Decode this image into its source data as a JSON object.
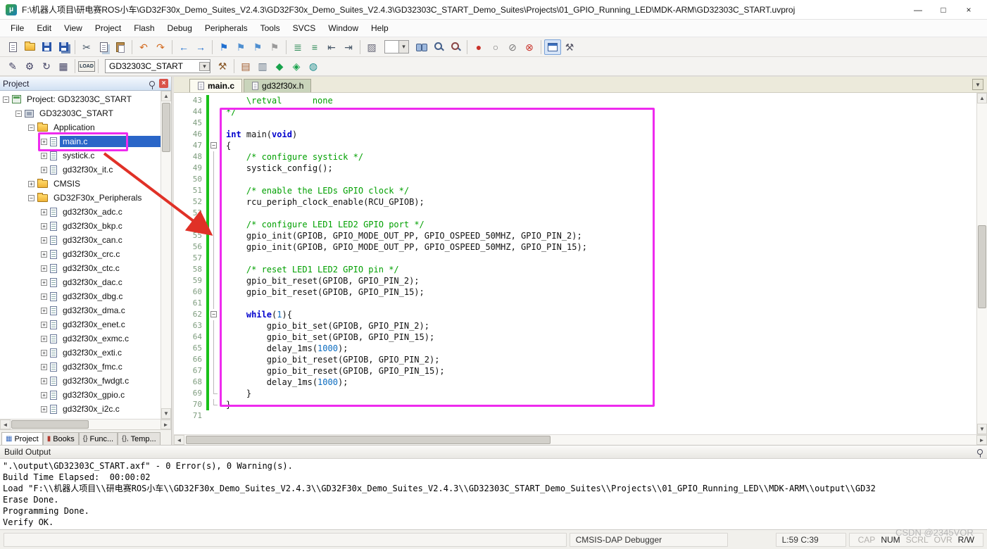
{
  "window": {
    "title": "F:\\机器人项目\\研电赛ROS小车\\GD32F30x_Demo_Suites_V2.4.3\\GD32F30x_Demo_Suites_V2.4.3\\GD32303C_START_Demo_Suites\\Projects\\01_GPIO_Running_LED\\MDK-ARM\\GD32303C_START.uvproj",
    "controls": {
      "minimize": "—",
      "maximize": "□",
      "close": "×"
    }
  },
  "menubar": {
    "items": [
      "File",
      "Edit",
      "View",
      "Project",
      "Flash",
      "Debug",
      "Peripherals",
      "Tools",
      "SVCS",
      "Window",
      "Help"
    ]
  },
  "toolbar_main": {
    "items": [
      {
        "name": "new-file-icon",
        "cls": "ic-page"
      },
      {
        "name": "open-folder-icon",
        "cls": "ic-folder"
      },
      {
        "name": "save-icon",
        "cls": "ic-floppy"
      },
      {
        "name": "save-all-icon",
        "cls": "ic-floppy ic-floppy-all"
      },
      {
        "sep": true
      },
      {
        "name": "cut-icon",
        "glyph": "✂",
        "color": "#445566"
      },
      {
        "name": "copy-icon",
        "cls": "ic-page ic-copy"
      },
      {
        "name": "paste-icon",
        "cls": "ic-paste"
      },
      {
        "sep": true
      },
      {
        "name": "undo-icon",
        "glyph": "↶",
        "color": "#d2691e"
      },
      {
        "name": "redo-icon",
        "glyph": "↷",
        "color": "#d2691e"
      },
      {
        "sep": true
      },
      {
        "name": "navigate-back-icon",
        "glyph": "←",
        "color": "#1f6fd0"
      },
      {
        "name": "navigate-forward-icon",
        "glyph": "→",
        "color": "#1f6fd0"
      },
      {
        "sep": true
      },
      {
        "name": "bookmark-toggle-icon",
        "glyph": "⚑",
        "color": "#1f6fd0"
      },
      {
        "name": "bookmark-previous-icon",
        "glyph": "⚑",
        "color": "#4f8fd0"
      },
      {
        "name": "bookmark-next-icon",
        "glyph": "⚑",
        "color": "#4f8fd0"
      },
      {
        "name": "bookmark-clear-all-icon",
        "glyph": "⚑",
        "color": "#9a9a9a"
      },
      {
        "sep": true
      },
      {
        "name": "comment-selection-icon",
        "glyph": "≣",
        "color": "#2e8b57"
      },
      {
        "name": "uncomment-selection-icon",
        "glyph": "≡",
        "color": "#2e8b57"
      },
      {
        "name": "indent-left-icon",
        "glyph": "⇤",
        "color": "#445566"
      },
      {
        "name": "indent-right-icon",
        "glyph": "⇥",
        "color": "#445566"
      },
      {
        "sep": true
      },
      {
        "name": "edit-configuration-icon",
        "glyph": "▨",
        "color": "#666677"
      },
      {
        "combo": true,
        "name": "search-combo"
      },
      {
        "name": "find-in-files-icon",
        "cls": "ic-binoc"
      },
      {
        "name": "find-icon",
        "cls": "ic-mag"
      },
      {
        "name": "incremental-find-icon",
        "cls": "ic-mag ic-mag-inc"
      },
      {
        "sep": true
      },
      {
        "name": "breakpoint-insert-icon",
        "glyph": "●",
        "color": "#c9322a"
      },
      {
        "name": "breakpoint-enable-icon",
        "glyph": "○",
        "color": "#777777"
      },
      {
        "name": "breakpoints-disable-all-icon",
        "glyph": "⊘",
        "color": "#777777"
      },
      {
        "name": "breakpoints-kill-all-icon",
        "glyph": "⊗",
        "color": "#c9322a"
      },
      {
        "sep": true
      },
      {
        "name": "debug-windows-icon",
        "cls": "ic-window",
        "pressed": true
      },
      {
        "name": "configuration-wrench-icon",
        "glyph": "⚒",
        "color": "#556"
      }
    ]
  },
  "toolbar_build": {
    "items": [
      {
        "name": "translate-file-icon",
        "glyph": "✎",
        "color": "#444466"
      },
      {
        "name": "build-icon",
        "glyph": "⚙",
        "color": "#444466"
      },
      {
        "name": "rebuild-all-icon",
        "glyph": "↻",
        "color": "#444466"
      },
      {
        "name": "batch-build-icon",
        "glyph": "▦",
        "color": "#444466"
      },
      {
        "sep": true
      },
      {
        "name": "download-load-icon",
        "label": "LOAD"
      },
      {
        "sep": true
      },
      {
        "select": true,
        "name": "target-select",
        "value": "GD32303C_START"
      },
      {
        "name": "options-for-target-icon",
        "glyph": "⚒",
        "color": "#8a5a2a"
      },
      {
        "sep": true
      },
      {
        "name": "manage-project-items-icon",
        "glyph": "▤",
        "color": "#a05a2c"
      },
      {
        "name": "manage-books-icon",
        "glyph": "▥",
        "color": "#667788"
      },
      {
        "name": "manage-rte-icon",
        "glyph": "◆",
        "color": "#17a24b"
      },
      {
        "name": "select-software-packs-icon",
        "glyph": "◈",
        "color": "#17a24b"
      },
      {
        "name": "pack-installer-icon",
        "glyph": "◍",
        "color": "#178a8a"
      }
    ]
  },
  "project_panel": {
    "title": "Project",
    "tree": [
      {
        "depth": 0,
        "expand": "minus",
        "icon": "project",
        "label": "Project: GD32303C_START"
      },
      {
        "depth": 1,
        "expand": "minus",
        "icon": "target",
        "label": "GD32303C_START"
      },
      {
        "depth": 2,
        "expand": "minus",
        "icon": "folder",
        "label": "Application"
      },
      {
        "depth": 3,
        "expand": "plus",
        "icon": "file",
        "label": "main.c",
        "selected": true
      },
      {
        "depth": 3,
        "expand": "plus",
        "icon": "file",
        "label": "systick.c"
      },
      {
        "depth": 3,
        "expand": "plus",
        "icon": "file",
        "label": "gd32f30x_it.c"
      },
      {
        "depth": 2,
        "expand": "plus",
        "icon": "folder",
        "label": "CMSIS"
      },
      {
        "depth": 2,
        "expand": "minus",
        "icon": "folder",
        "label": "GD32F30x_Peripherals"
      },
      {
        "depth": 3,
        "expand": "plus",
        "icon": "file",
        "label": "gd32f30x_adc.c"
      },
      {
        "depth": 3,
        "expand": "plus",
        "icon": "file",
        "label": "gd32f30x_bkp.c"
      },
      {
        "depth": 3,
        "expand": "plus",
        "icon": "file",
        "label": "gd32f30x_can.c"
      },
      {
        "depth": 3,
        "expand": "plus",
        "icon": "file",
        "label": "gd32f30x_crc.c"
      },
      {
        "depth": 3,
        "expand": "plus",
        "icon": "file",
        "label": "gd32f30x_ctc.c"
      },
      {
        "depth": 3,
        "expand": "plus",
        "icon": "file",
        "label": "gd32f30x_dac.c"
      },
      {
        "depth": 3,
        "expand": "plus",
        "icon": "file",
        "label": "gd32f30x_dbg.c"
      },
      {
        "depth": 3,
        "expand": "plus",
        "icon": "file",
        "label": "gd32f30x_dma.c"
      },
      {
        "depth": 3,
        "expand": "plus",
        "icon": "file",
        "label": "gd32f30x_enet.c"
      },
      {
        "depth": 3,
        "expand": "plus",
        "icon": "file",
        "label": "gd32f30x_exmc.c"
      },
      {
        "depth": 3,
        "expand": "plus",
        "icon": "file",
        "label": "gd32f30x_exti.c"
      },
      {
        "depth": 3,
        "expand": "plus",
        "icon": "file",
        "label": "gd32f30x_fmc.c"
      },
      {
        "depth": 3,
        "expand": "plus",
        "icon": "file",
        "label": "gd32f30x_fwdgt.c"
      },
      {
        "depth": 3,
        "expand": "plus",
        "icon": "file",
        "label": "gd32f30x_gpio.c"
      },
      {
        "depth": 3,
        "expand": "plus",
        "icon": "file",
        "label": "gd32f30x_i2c.c"
      }
    ],
    "tabs": [
      {
        "label": "Project",
        "glyph": "▦",
        "color": "#3f6fbf",
        "active": true
      },
      {
        "label": "Books",
        "glyph": "▮",
        "color": "#b23a2e",
        "active": false
      },
      {
        "label": "Func...",
        "glyph": "{}",
        "color": "#333333",
        "active": false
      },
      {
        "label": "Temp...",
        "glyph": "{},",
        "color": "#333333",
        "active": false
      }
    ]
  },
  "editor": {
    "tabs": [
      {
        "label": "main.c",
        "active": true
      },
      {
        "label": "gd32f30x.h",
        "active": false
      }
    ],
    "lines": [
      {
        "n": 43,
        "chg": true,
        "seg": [
          [
            "cm",
            "    \\retval      none"
          ]
        ]
      },
      {
        "n": 44,
        "chg": true,
        "seg": [
          [
            "cm",
            "*/"
          ]
        ]
      },
      {
        "n": 45,
        "chg": true,
        "seg": []
      },
      {
        "n": 46,
        "chg": true,
        "seg": [
          [
            "kw",
            "int"
          ],
          [
            "pl",
            " main("
          ],
          [
            "kw",
            "void"
          ],
          [
            "pl",
            ")"
          ]
        ]
      },
      {
        "n": 47,
        "chg": true,
        "fold": "box",
        "seg": [
          [
            "pl",
            "{"
          ]
        ]
      },
      {
        "n": 48,
        "chg": true,
        "fold": "line",
        "seg": [
          [
            "pl",
            "    "
          ],
          [
            "cm",
            "/* configure systick */"
          ]
        ]
      },
      {
        "n": 49,
        "chg": true,
        "fold": "line",
        "seg": [
          [
            "pl",
            "    systick_config();"
          ]
        ]
      },
      {
        "n": 50,
        "chg": true,
        "fold": "line",
        "seg": []
      },
      {
        "n": 51,
        "chg": true,
        "fold": "line",
        "seg": [
          [
            "pl",
            "    "
          ],
          [
            "cm",
            "/* enable the LEDs GPIO clock */"
          ]
        ]
      },
      {
        "n": 52,
        "chg": true,
        "fold": "line",
        "seg": [
          [
            "pl",
            "    rcu_periph_clock_enable(RCU_GPIOB);"
          ]
        ]
      },
      {
        "n": 53,
        "chg": true,
        "fold": "line",
        "seg": []
      },
      {
        "n": 54,
        "chg": true,
        "fold": "line",
        "seg": [
          [
            "pl",
            "    "
          ],
          [
            "cm",
            "/* configure LED1 LED2 GPIO port */"
          ]
        ]
      },
      {
        "n": 55,
        "chg": true,
        "fold": "line",
        "seg": [
          [
            "pl",
            "    gpio_init(GPIOB, GPIO_MODE_OUT_PP, GPIO_OSPEED_50MHZ, GPIO_PIN_2);"
          ]
        ]
      },
      {
        "n": 56,
        "chg": true,
        "fold": "line",
        "seg": [
          [
            "pl",
            "    gpio_init(GPIOB, GPIO_MODE_OUT_PP, GPIO_OSPEED_50MHZ, GPIO_PIN_15);"
          ]
        ]
      },
      {
        "n": 57,
        "chg": true,
        "fold": "line",
        "seg": []
      },
      {
        "n": 58,
        "chg": true,
        "fold": "line",
        "seg": [
          [
            "pl",
            "    "
          ],
          [
            "cm",
            "/* reset LED1 LED2 GPIO pin */"
          ]
        ]
      },
      {
        "n": 59,
        "chg": true,
        "fold": "line",
        "seg": [
          [
            "pl",
            "    gpio_bit_reset(GPIOB, GPIO_PIN_2);"
          ]
        ]
      },
      {
        "n": 60,
        "chg": true,
        "fold": "line",
        "seg": [
          [
            "pl",
            "    gpio_bit_reset(GPIOB, GPIO_PIN_15);"
          ]
        ]
      },
      {
        "n": 61,
        "chg": true,
        "fold": "line",
        "seg": []
      },
      {
        "n": 62,
        "chg": true,
        "fold": "box",
        "seg": [
          [
            "pl",
            "    "
          ],
          [
            "kw",
            "while"
          ],
          [
            "pl",
            "("
          ],
          [
            "num",
            "1"
          ],
          [
            "pl",
            "){"
          ]
        ]
      },
      {
        "n": 63,
        "chg": true,
        "fold": "line",
        "seg": [
          [
            "pl",
            "        gpio_bit_set(GPIOB, GPIO_PIN_2);"
          ]
        ]
      },
      {
        "n": 64,
        "chg": true,
        "fold": "line",
        "seg": [
          [
            "pl",
            "        gpio_bit_set(GPIOB, GPIO_PIN_15);"
          ]
        ]
      },
      {
        "n": 65,
        "chg": true,
        "fold": "line",
        "seg": [
          [
            "pl",
            "        delay_1ms("
          ],
          [
            "num",
            "1000"
          ],
          [
            "pl",
            ");"
          ]
        ]
      },
      {
        "n": 66,
        "chg": true,
        "fold": "line",
        "seg": [
          [
            "pl",
            "        gpio_bit_reset(GPIOB, GPIO_PIN_2);"
          ]
        ]
      },
      {
        "n": 67,
        "chg": true,
        "fold": "line",
        "seg": [
          [
            "pl",
            "        gpio_bit_reset(GPIOB, GPIO_PIN_15);"
          ]
        ]
      },
      {
        "n": 68,
        "chg": true,
        "fold": "line",
        "seg": [
          [
            "pl",
            "        delay_1ms("
          ],
          [
            "num",
            "1000"
          ],
          [
            "pl",
            ");"
          ]
        ]
      },
      {
        "n": 69,
        "chg": true,
        "fold": "end",
        "seg": [
          [
            "pl",
            "    }"
          ]
        ]
      },
      {
        "n": 70,
        "chg": true,
        "fold": "end",
        "seg": [
          [
            "pl",
            "}"
          ]
        ]
      },
      {
        "n": 71,
        "seg": []
      }
    ]
  },
  "build_output": {
    "title": "Build Output",
    "lines": [
      "\".\\output\\GD32303C_START.axf\" - 0 Error(s), 0 Warning(s).",
      "Build Time Elapsed:  00:00:02",
      "Load \"F:\\\\机器人项目\\\\研电赛ROS小车\\\\GD32F30x_Demo_Suites_V2.4.3\\\\GD32F30x_Demo_Suites_V2.4.3\\\\GD32303C_START_Demo_Suites\\\\Projects\\\\01_GPIO_Running_LED\\\\MDK-ARM\\\\output\\\\GD32",
      "Erase Done.",
      "Programming Done.",
      "Verify OK."
    ]
  },
  "statusbar": {
    "debugger": "CMSIS-DAP Debugger",
    "cursor": "L:59 C:39",
    "flags": [
      {
        "label": "CAP",
        "active": false
      },
      {
        "label": "NUM",
        "active": true
      },
      {
        "label": "SCRL",
        "active": false
      },
      {
        "label": "OVR",
        "active": false
      },
      {
        "label": "R/W",
        "active": true
      }
    ],
    "watermark": "CSDN @2345VOR"
  },
  "colors": {
    "annotation": "#ee2bee",
    "arrow": "#e03127",
    "selection": "#2a66c8",
    "comment": "#00a000",
    "keyword": "#0000cd",
    "number": "#0a6bbf"
  }
}
